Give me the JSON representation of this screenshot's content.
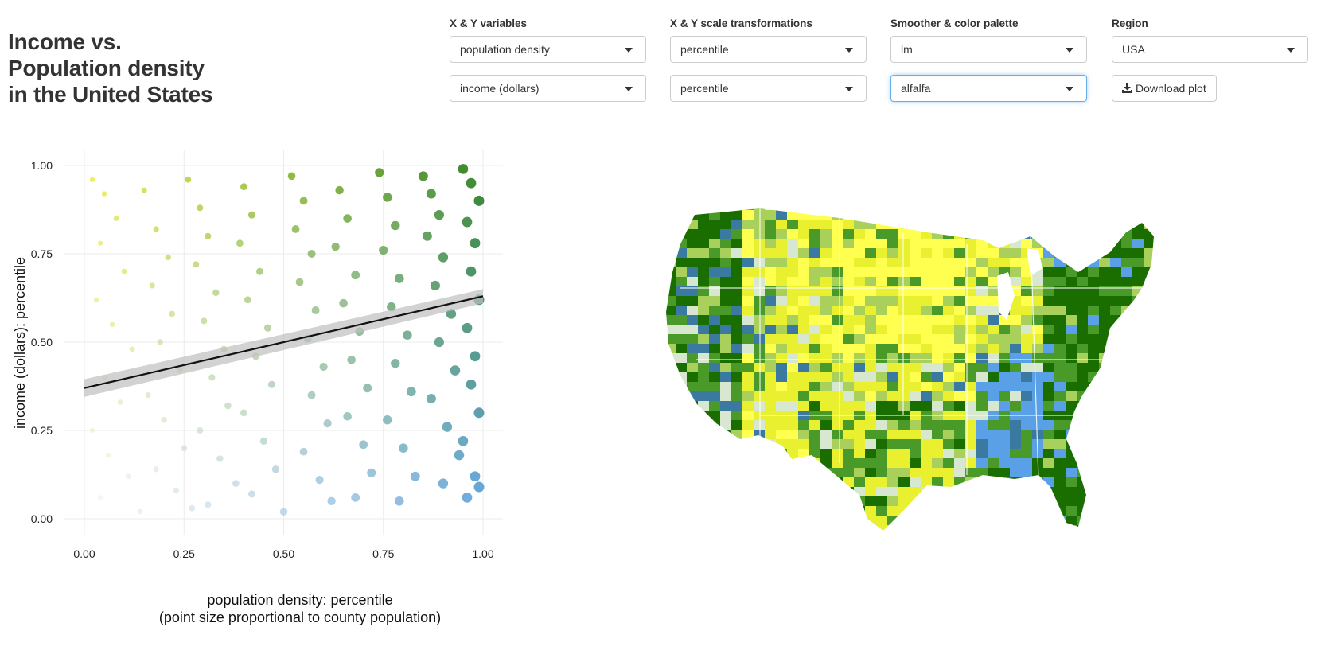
{
  "title": {
    "line1": "Income vs.",
    "line2": "Population density",
    "line3": "in the United States"
  },
  "controls": {
    "xy_variables": {
      "label": "X & Y variables",
      "x_value": "population density",
      "y_value": "income (dollars)"
    },
    "scale_transforms": {
      "label": "X & Y scale transformations",
      "x_value": "percentile",
      "y_value": "percentile"
    },
    "smoother_palette": {
      "label": "Smoother & color palette",
      "smoother_value": "lm",
      "palette_value": "alfalfa"
    },
    "region": {
      "label": "Region",
      "value": "USA"
    },
    "download": {
      "label": "Download plot",
      "icon": "download-icon"
    }
  },
  "colors": {
    "palette_low": "#ffff66",
    "palette_mid": "#2e8b57",
    "palette_high": "#1a6e00",
    "palette_blue": "#5aa0e6",
    "accent_focus": "#66afe9"
  },
  "chart_data": {
    "type": "scatter",
    "xlabel": "population density: percentile",
    "xlabel_sub": "(point size proportional to county population)",
    "ylabel": "income (dollars): percentile",
    "xlim": [
      0,
      1
    ],
    "ylim": [
      0,
      1
    ],
    "x_ticks": [
      "0.00",
      "0.25",
      "0.50",
      "0.75",
      "1.00"
    ],
    "y_ticks": [
      "0.00",
      "0.25",
      "0.50",
      "0.75",
      "1.00"
    ],
    "grid": true,
    "legend": "none",
    "smoother": {
      "method": "lm",
      "x": [
        0,
        1
      ],
      "y": [
        0.37,
        0.63
      ],
      "band_halfwidth": [
        0.025,
        0.02
      ]
    },
    "series": [
      {
        "points": [
          [
            0.02,
            0.96
          ],
          [
            0.05,
            0.92
          ],
          [
            0.08,
            0.85
          ],
          [
            0.04,
            0.78
          ],
          [
            0.1,
            0.7
          ],
          [
            0.03,
            0.62
          ],
          [
            0.07,
            0.55
          ],
          [
            0.12,
            0.48
          ],
          [
            0.05,
            0.4
          ],
          [
            0.09,
            0.33
          ],
          [
            0.02,
            0.25
          ],
          [
            0.06,
            0.18
          ],
          [
            0.11,
            0.12
          ],
          [
            0.04,
            0.06
          ],
          [
            0.14,
            0.02
          ],
          [
            0.15,
            0.93
          ],
          [
            0.18,
            0.82
          ],
          [
            0.21,
            0.74
          ],
          [
            0.17,
            0.66
          ],
          [
            0.22,
            0.58
          ],
          [
            0.19,
            0.5
          ],
          [
            0.24,
            0.42
          ],
          [
            0.16,
            0.35
          ],
          [
            0.2,
            0.28
          ],
          [
            0.25,
            0.2
          ],
          [
            0.18,
            0.14
          ],
          [
            0.23,
            0.08
          ],
          [
            0.27,
            0.03
          ],
          [
            0.26,
            0.96
          ],
          [
            0.29,
            0.88
          ],
          [
            0.31,
            0.8
          ],
          [
            0.28,
            0.72
          ],
          [
            0.33,
            0.64
          ],
          [
            0.3,
            0.56
          ],
          [
            0.35,
            0.48
          ],
          [
            0.32,
            0.4
          ],
          [
            0.36,
            0.32
          ],
          [
            0.29,
            0.25
          ],
          [
            0.34,
            0.17
          ],
          [
            0.38,
            0.1
          ],
          [
            0.31,
            0.04
          ],
          [
            0.4,
            0.94
          ],
          [
            0.42,
            0.86
          ],
          [
            0.39,
            0.78
          ],
          [
            0.44,
            0.7
          ],
          [
            0.41,
            0.62
          ],
          [
            0.46,
            0.54
          ],
          [
            0.43,
            0.46
          ],
          [
            0.47,
            0.38
          ],
          [
            0.4,
            0.3
          ],
          [
            0.45,
            0.22
          ],
          [
            0.48,
            0.14
          ],
          [
            0.42,
            0.07
          ],
          [
            0.5,
            0.02
          ],
          [
            0.52,
            0.97
          ],
          [
            0.55,
            0.9
          ],
          [
            0.53,
            0.82
          ],
          [
            0.57,
            0.75
          ],
          [
            0.54,
            0.67
          ],
          [
            0.58,
            0.59
          ],
          [
            0.56,
            0.51
          ],
          [
            0.6,
            0.43
          ],
          [
            0.57,
            0.35
          ],
          [
            0.61,
            0.27
          ],
          [
            0.55,
            0.19
          ],
          [
            0.59,
            0.11
          ],
          [
            0.62,
            0.05
          ],
          [
            0.64,
            0.93
          ],
          [
            0.66,
            0.85
          ],
          [
            0.63,
            0.77
          ],
          [
            0.68,
            0.69
          ],
          [
            0.65,
            0.61
          ],
          [
            0.69,
            0.53
          ],
          [
            0.67,
            0.45
          ],
          [
            0.71,
            0.37
          ],
          [
            0.66,
            0.29
          ],
          [
            0.7,
            0.21
          ],
          [
            0.72,
            0.13
          ],
          [
            0.68,
            0.06
          ],
          [
            0.74,
            0.98
          ],
          [
            0.76,
            0.91
          ],
          [
            0.78,
            0.83
          ],
          [
            0.75,
            0.76
          ],
          [
            0.79,
            0.68
          ],
          [
            0.77,
            0.6
          ],
          [
            0.81,
            0.52
          ],
          [
            0.78,
            0.44
          ],
          [
            0.82,
            0.36
          ],
          [
            0.76,
            0.28
          ],
          [
            0.8,
            0.2
          ],
          [
            0.83,
            0.12
          ],
          [
            0.79,
            0.05
          ],
          [
            0.85,
            0.97
          ],
          [
            0.87,
            0.92
          ],
          [
            0.89,
            0.86
          ],
          [
            0.86,
            0.8
          ],
          [
            0.9,
            0.74
          ],
          [
            0.88,
            0.66
          ],
          [
            0.92,
            0.58
          ],
          [
            0.89,
            0.5
          ],
          [
            0.93,
            0.42
          ],
          [
            0.87,
            0.34
          ],
          [
            0.91,
            0.26
          ],
          [
            0.94,
            0.18
          ],
          [
            0.9,
            0.1
          ],
          [
            0.95,
            0.99
          ],
          [
            0.97,
            0.95
          ],
          [
            0.99,
            0.9
          ],
          [
            0.96,
            0.84
          ],
          [
            0.98,
            0.78
          ],
          [
            0.97,
            0.7
          ],
          [
            0.99,
            0.62
          ],
          [
            0.96,
            0.54
          ],
          [
            0.98,
            0.46
          ],
          [
            0.97,
            0.38
          ],
          [
            0.99,
            0.3
          ],
          [
            0.95,
            0.22
          ],
          [
            0.98,
            0.12
          ],
          [
            0.96,
            0.06
          ],
          [
            0.99,
            0.09
          ]
        ]
      }
    ]
  },
  "map": {
    "region": "USA",
    "description_colors": [
      "#1a6e00",
      "#4a9a2a",
      "#a8d05a",
      "#e8f030",
      "#ffff50",
      "#d8e8d0",
      "#5aa0e6",
      "#3a7aa0"
    ]
  }
}
